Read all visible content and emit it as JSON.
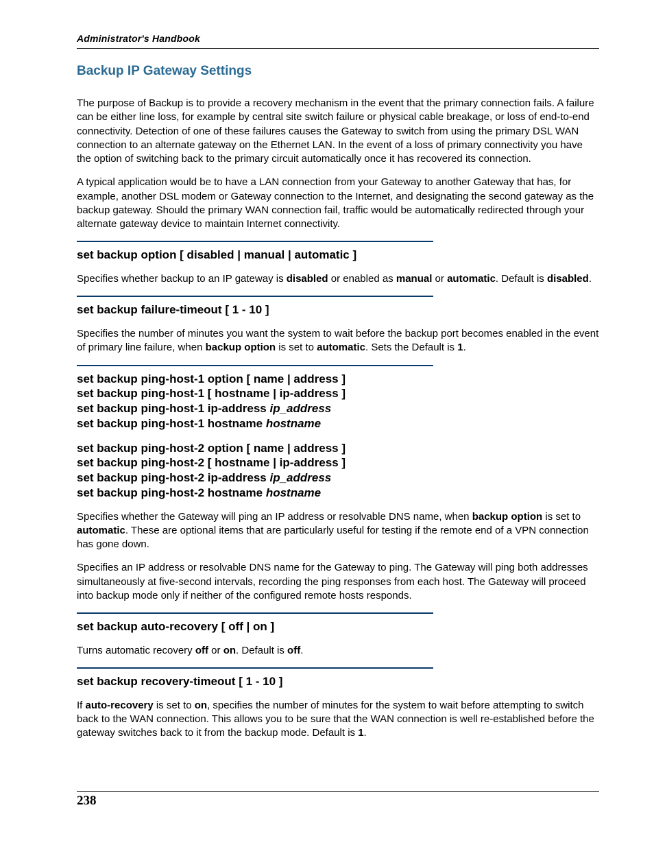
{
  "runhead": "Administrator's Handbook",
  "page_number": "238",
  "title": "Backup IP Gateway Settings",
  "intro_p1": "The purpose of Backup is to provide a recovery mechanism in the event that the primary connection fails. A failure can be either line loss, for example by central site switch failure or physical cable breakage, or loss of end-to-end connectivity. Detection of one of these failures causes the Gateway to switch from using the primary DSL WAN connection to an alternate gateway on the Ethernet LAN. In the event of a loss of primary connectivity you have the option of switching back to the primary circuit automatically once it has recovered its connection.",
  "intro_p2": "A typical application would be to have a LAN connection from your Gateway to another Gateway that has, for example, another DSL modem or Gateway connection to the Internet, and designating the second gateway as the backup gateway. Should the primary WAN connection fail, traffic would be automatically redirected through your alternate gateway device to maintain Internet connectivity.",
  "cmd1": "set backup option [ disabled | manual | automatic ]",
  "cmd1_desc_a": "Specifies whether backup to an IP gateway is ",
  "cmd1_desc_b": "disabled",
  "cmd1_desc_c": " or enabled as ",
  "cmd1_desc_d": "manual",
  "cmd1_desc_e": " or ",
  "cmd1_desc_f": "automatic",
  "cmd1_desc_g": ". Default is ",
  "cmd1_desc_h": "disabled",
  "cmd1_desc_i": ".",
  "cmd2": "set backup failure-timeout [ 1 - 10 ]",
  "cmd2_desc_a": "Specifies the number of minutes you want the system to wait before the backup port becomes enabled in the event of primary line failure, when ",
  "cmd2_desc_b": "backup option",
  "cmd2_desc_c": " is set to ",
  "cmd2_desc_d": "automatic",
  "cmd2_desc_e": ". Sets the Default is ",
  "cmd2_desc_f": "1",
  "cmd2_desc_g": ".",
  "cmd3_l1": "set backup ping-host-1 option [ name | address ]",
  "cmd3_l2": "set backup ping-host-1 [ hostname | ip-address ]",
  "cmd3_l3a": "set backup ping-host-1 ip-address ",
  "cmd3_l3b": "ip_address",
  "cmd3_l4a": "set backup ping-host-1 hostname ",
  "cmd3_l4b": "hostname",
  "cmd4_l1": "set backup ping-host-2 option [ name | address ]",
  "cmd4_l2": "set backup ping-host-2 [ hostname | ip-address ]",
  "cmd4_l3a": "set backup ping-host-2 ip-address ",
  "cmd4_l3b": "ip_address",
  "cmd4_l4a": "set backup ping-host-2 hostname ",
  "cmd4_l4b": "hostname",
  "cmd34_p1a": "Specifies whether the Gateway will ping an IP address or resolvable DNS name, when ",
  "cmd34_p1b": "backup option",
  "cmd34_p1c": " is set to ",
  "cmd34_p1d": "automatic",
  "cmd34_p1e": ". These are optional items that are particularly useful for testing if the remote end of a VPN connection has gone down.",
  "cmd34_p2": "Specifies an IP address or resolvable DNS name for the Gateway to ping. The Gateway will ping both addresses simultaneously at five-second intervals, recording the ping responses from each host. The Gateway will proceed into backup mode only if neither of the configured remote hosts responds.",
  "cmd5": "set backup auto-recovery [ off | on ]",
  "cmd5_desc_a": "Turns automatic recovery ",
  "cmd5_desc_b": "off",
  "cmd5_desc_c": " or ",
  "cmd5_desc_d": "on",
  "cmd5_desc_e": ". Default is ",
  "cmd5_desc_f": "off",
  "cmd5_desc_g": ".",
  "cmd6": "set backup recovery-timeout [ 1 - 10 ]",
  "cmd6_desc_a": "If ",
  "cmd6_desc_b": "auto-recovery",
  "cmd6_desc_c": " is set to ",
  "cmd6_desc_d": "on",
  "cmd6_desc_e": ", specifies the number of minutes for the system to wait before attempting to switch back to the WAN connection. This allows you to be sure that the WAN connection is well re-established before the gateway switches back to it from the backup mode. Default is ",
  "cmd6_desc_f": "1",
  "cmd6_desc_g": "."
}
